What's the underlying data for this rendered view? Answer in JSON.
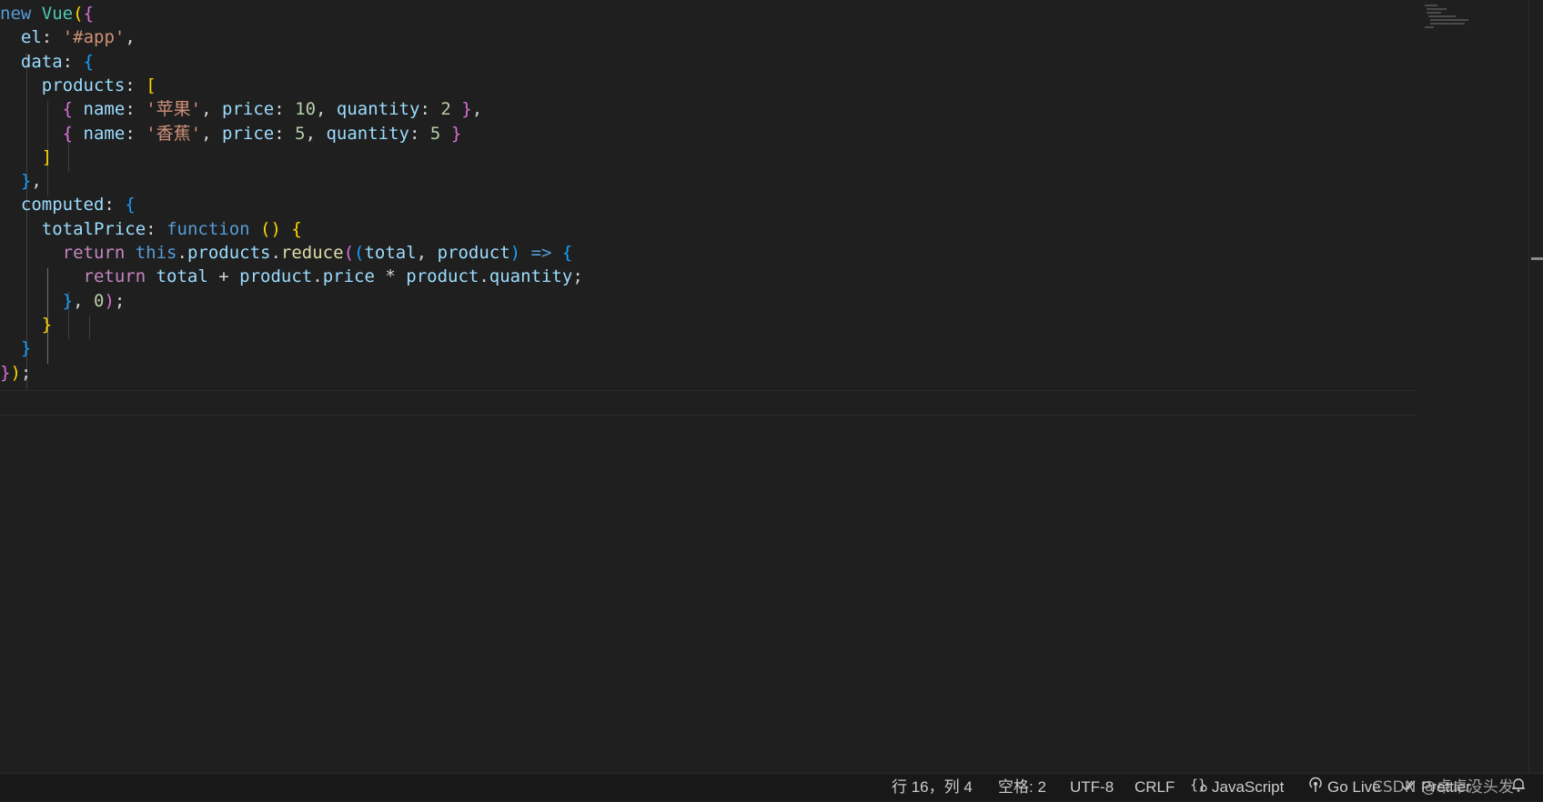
{
  "editor": {
    "language": "JavaScript",
    "lines": [
      "new Vue({",
      "  el: '#app',",
      "  data: {",
      "    products: [",
      "      { name: '苹果', price: 10, quantity: 2 },",
      "      { name: '香蕉', price: 5, quantity: 5 }",
      "    ]",
      "  },",
      "  computed: {",
      "    totalPrice: function () {",
      "      return this.products.reduce((total, product) => {",
      "        return total + product.price * product.quantity;",
      "      }, 0);",
      "    }",
      "  }",
      "});"
    ],
    "cursor_line": 16
  },
  "statusbar": {
    "position": "行 16，列 4",
    "indent": "空格: 2",
    "encoding": "UTF-8",
    "eol": "CRLF",
    "language_mode": "JavaScript",
    "go_live": "Go Live",
    "prettier": "Prettier",
    "icons": {
      "language": "braces-icon",
      "go_live": "broadcast-icon",
      "prettier": "double-check-icon",
      "notifications": "bell-icon"
    }
  },
  "watermark": "CSDN @卓卓没头发",
  "colors": {
    "background": "#1f1f1f",
    "keyword": "#569cd6",
    "control": "#c586c0",
    "function": "#dcdcaa",
    "string": "#ce9178",
    "number": "#b5cea8",
    "variable": "#9cdcfe",
    "bracket_gold": "#ffd700",
    "bracket_orchid": "#da70d6",
    "bracket_blue": "#179fff"
  }
}
